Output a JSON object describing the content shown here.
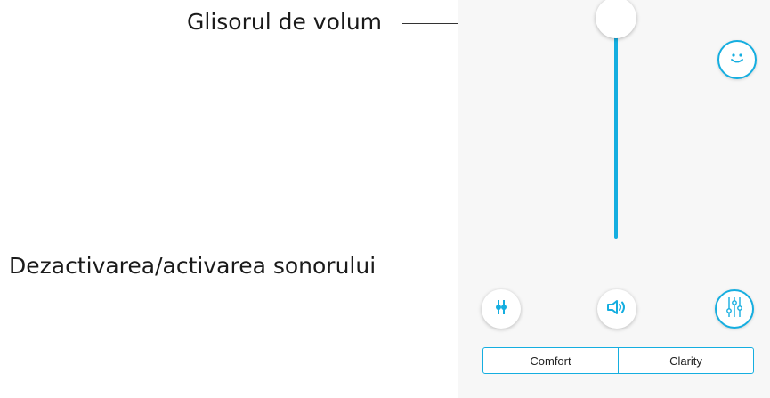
{
  "callouts": {
    "volume_slider": "Glisorul de volum",
    "mute_toggle": "Dezactivarea/activarea sonorului"
  },
  "app": {
    "volume": {
      "level": 1.0
    },
    "icons": {
      "mood": "smiley-face-icon",
      "equalizer_left": "sliders-icon",
      "mute": "speaker-icon",
      "equalizer_right": "equalizer-icon"
    },
    "programs": {
      "options": [
        "Comfort",
        "Clarity"
      ]
    }
  },
  "colors": {
    "accent": "#15aee0",
    "panel_background": "#f7f7f7",
    "label_text": "#1a1a1a"
  }
}
